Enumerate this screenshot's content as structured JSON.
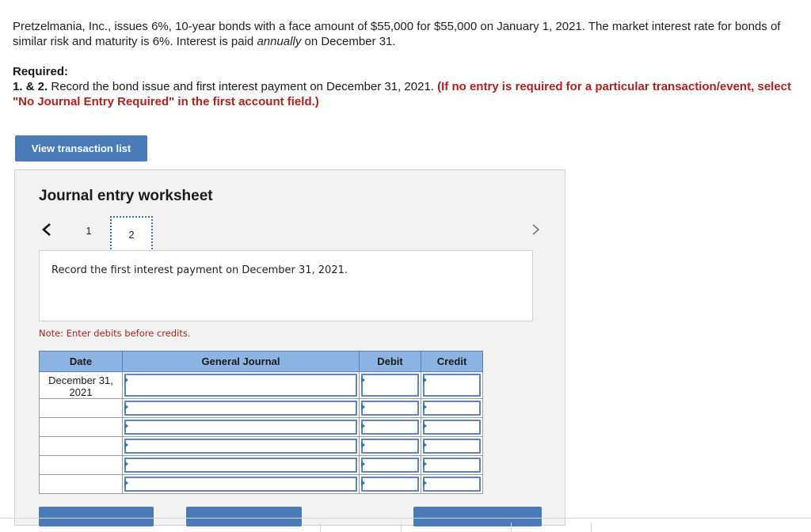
{
  "problem": {
    "text_1": "Pretzelmania, Inc., issues 6%, 10-year bonds with a face amount of $55,000 for $55,000 on January 1, 2021. The market interest rate for bonds of similar risk and maturity is 6%. Interest is paid ",
    "text_em": "annually",
    "text_2": " on December 31."
  },
  "required": {
    "title": "Required:",
    "number": "1. & 2.",
    "text": " Record the bond issue and first interest payment on December 31, 2021. ",
    "red_text": "(If no entry is required for a particular transaction/event, select \"No Journal Entry Required\" in the first account field.)"
  },
  "buttons": {
    "view_transaction_list": "View transaction list"
  },
  "worksheet": {
    "title": "Journal entry worksheet",
    "tabs": [
      "1",
      "2"
    ],
    "active_tab": "2",
    "instruction": "Record the first interest payment on December 31, 2021.",
    "note": "Note: Enter debits before credits."
  },
  "journal": {
    "headers": {
      "date": "Date",
      "general_journal": "General Journal",
      "debit": "Debit",
      "credit": "Credit"
    },
    "first_date": "December 31, 2021",
    "rows": 6
  },
  "colors": {
    "accent": "#4a7ab8",
    "header_fill": "#8db3e2",
    "alert_red": "#b0211b"
  },
  "icons": [
    "chevron-left-icon",
    "chevron-right-icon",
    "dropdown-marker-icon"
  ]
}
